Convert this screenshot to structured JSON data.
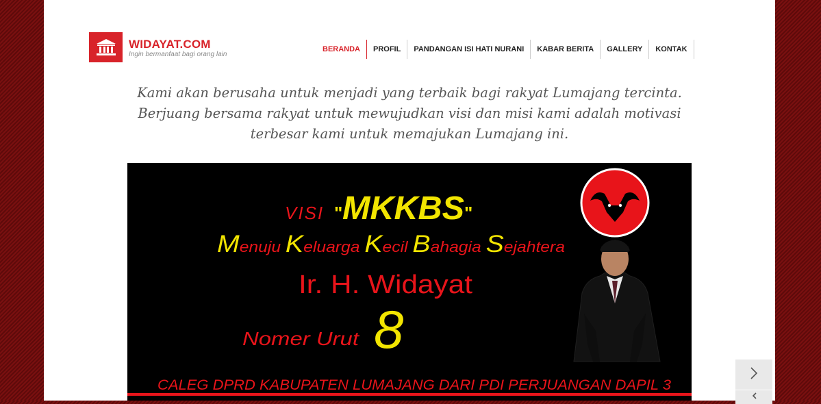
{
  "site": {
    "logo_title": "WIDAYAT.COM",
    "logo_tagline": "Ingin bermanfaat bagi orang lain",
    "logo_icon": "institution-icon"
  },
  "nav": {
    "items": [
      {
        "label": "BERANDA",
        "active": true
      },
      {
        "label": "PROFIL"
      },
      {
        "label": "PANDANGAN ISI HATI NURANI"
      },
      {
        "label": "KABAR BERITA"
      },
      {
        "label": "GALLERY"
      },
      {
        "label": "KONTAK"
      }
    ]
  },
  "intro": {
    "line1": "Kami akan berusaha untuk menjadi yang terbaik bagi rakyat Lumajang tercinta.",
    "line2": "Berjuang bersama rakyat untuk mewujudkan visi dan misi kami adalah motivasi",
    "line3": "terbesar kami untuk memajukan Lumajang ini."
  },
  "banner": {
    "visi_label": "VISI",
    "visi_open_quote": "\"",
    "visi_word": "MKKBS",
    "visi_close_quote": "\"",
    "motto": [
      {
        "initial": "M",
        "rest": "enuju "
      },
      {
        "initial": "K",
        "rest": "eluarga "
      },
      {
        "initial": "K",
        "rest": "ecil "
      },
      {
        "initial": "B",
        "rest": "ahagia "
      },
      {
        "initial": "S",
        "rest": "ejahtera"
      }
    ],
    "candidate_name": "Ir. H. Widayat",
    "number_label": "Nomer Urut",
    "number": "8",
    "bottom_text": "CALEG DPRD KABUPATEN LUMAJANG DARI PDI PERJUANGAN DAPIL 3",
    "party_logo": "bull-logo-icon",
    "photo": "candidate-portrait"
  },
  "colors": {
    "brand_red": "#d8232a",
    "banner_yellow": "#f2e500",
    "banner_red": "#e8141a",
    "background": "#6a0d0d"
  },
  "slider": {
    "next_icon": "chevron-right-icon",
    "prev_icon": "chevron-left-icon"
  }
}
